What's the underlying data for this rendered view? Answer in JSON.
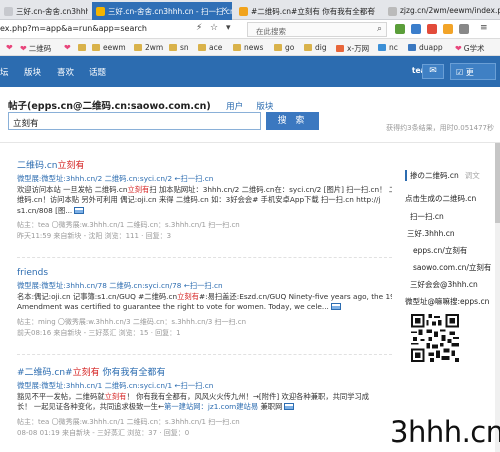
{
  "browser": {
    "tabs": [
      {
        "label": "三好.cn-舍舍.cn3hhh.c"
      },
      {
        "label": "三好.cn-舍舍.cn3hhh.cn - 扫一扫.cn"
      },
      {
        "label": "#二维码.cn#立刻有 你有我有全都有"
      },
      {
        "label": "zjzg.cn/2wm/eewm/index.php?"
      }
    ],
    "url": "ex.php?m=app&a=run&app=search",
    "search_placeholder": "在此搜索",
    "bookmarks": [
      {
        "label": "二维码"
      },
      {
        "label": "eewm"
      },
      {
        "label": "2wm"
      },
      {
        "label": "sn"
      },
      {
        "label": "ace"
      },
      {
        "label": "news"
      },
      {
        "label": "go"
      },
      {
        "label": "dig"
      },
      {
        "label": "x-万网"
      },
      {
        "label": "nc"
      },
      {
        "label": "duapp"
      },
      {
        "label": "G学术"
      }
    ]
  },
  "site_nav": {
    "items": [
      {
        "label": "坛"
      },
      {
        "label": "版块"
      },
      {
        "label": "喜欢"
      },
      {
        "label": "话题"
      }
    ],
    "user": "tea",
    "more_label": "更"
  },
  "search": {
    "heading": "帖子(epps.cn@二维码.cn:saowo.com.cn)",
    "link_users": "用户",
    "link_boards": "版块",
    "query": "立刻有",
    "button": "搜 索",
    "stats": "获得约3条结果，用时0.051477秒"
  },
  "results": [
    {
      "title_pre": "二维码.cn",
      "title_hl": "立刻有",
      "line1": "微型展:微型址:3hhh.cn/2 二维码.cn:syci.cn/2 ←扫一扫.cn",
      "body1_a": "欢迎访问本站 一旦发帖 二维码.cn",
      "body1_hl": "立刻有",
      "body1_b": "扫 加本贴网址：3hhh.cn/2 二维码.cn在：syci.cn/2 [图片] 扫一扫.cn！ 二",
      "body2": "维码.cn！访问本贴 另外可利用 偶记:oji.cn 来得 二维码.cn 如：3好会会# 手机安卓App下载 扫一扫.cn http://j",
      "body3": "s1.cn/808 [图...",
      "meta1": "帖主：tea 〇微秀展:w.3hhh.cn/1 二维码.cn：s.3hhh.cn/1 扫一扫.cn",
      "meta2": "昨天11:59 来自新块 - 沈阳 浏览：111 · 回复：3"
    },
    {
      "title_pre": "friends",
      "title_hl": "",
      "line1": "微型展:微型址:3hhh.cn/78 二维码.cn:syci.cn/78 ←扫一扫.cn",
      "body1_a": "名本:偶记:oji.cn 记事簿:s1.cn/GUQ #二维码.cn",
      "body1_hl": "立刻有",
      "body1_b": "#:易扫盖还:Eszd.cn/GUQ Ninety-five years ago, the 19th",
      "body2": "Amendment was certified to guarantee the right to vote for women. Today, we cele...",
      "body3": "",
      "meta1": "帖主：ming 〇微秀展:w.3hhh.cn/3 二维码.cn：s.3hhh.cn/3 扫一扫.cn",
      "meta2": "前天08:16 来自新块 - 三好蒸汇 浏览：15 · 回复：1"
    },
    {
      "title_pre": "#二维码.cn#",
      "title_hl": "立刻有",
      "title_post": " 你有我有全都有",
      "line1": "微型展:微型址:3hhh.cn/1 二维码.cn:syci.cn/1 ←扫一扫.cn",
      "body1_a": "豁见不平一发帖，二维码就",
      "body1_hl": "立刻有",
      "body1_b": "！ 你有我有全都有，风风火火传九州！→[附件] 欢迎各种兼职，共同学习成",
      "body2": "长！ 一起见证各种变化，共同追求极致一生←",
      "body2_link": "第一建站网：jz1.com建站易",
      "body2_tail": "兼职网",
      "body3": "",
      "meta1": "帖主：tea 〇微秀展:w.3hhh.cn/1 二维码.cn：s.3hhh.cn/1 扫一扫.cn",
      "meta2": "08-08 01:19 来自新块 - 三好蒸汇 浏览：37 · 回复：0"
    }
  ],
  "sidebar": {
    "heading": "掺の二维码.cn",
    "more": "调文",
    "links": [
      {
        "label": "点击生成の二维码.cn"
      },
      {
        "label": "扫一扫.cn"
      },
      {
        "label": "三好.3hhh.cn"
      },
      {
        "label": "epps.cn/立刻有"
      },
      {
        "label": "saowo.com.cn/立刻有"
      },
      {
        "label": "三好会会@3hhh.cn"
      },
      {
        "label": "微型址@嘛嘛搜:epps.cn"
      }
    ]
  },
  "watermark": "3hhh.cn"
}
